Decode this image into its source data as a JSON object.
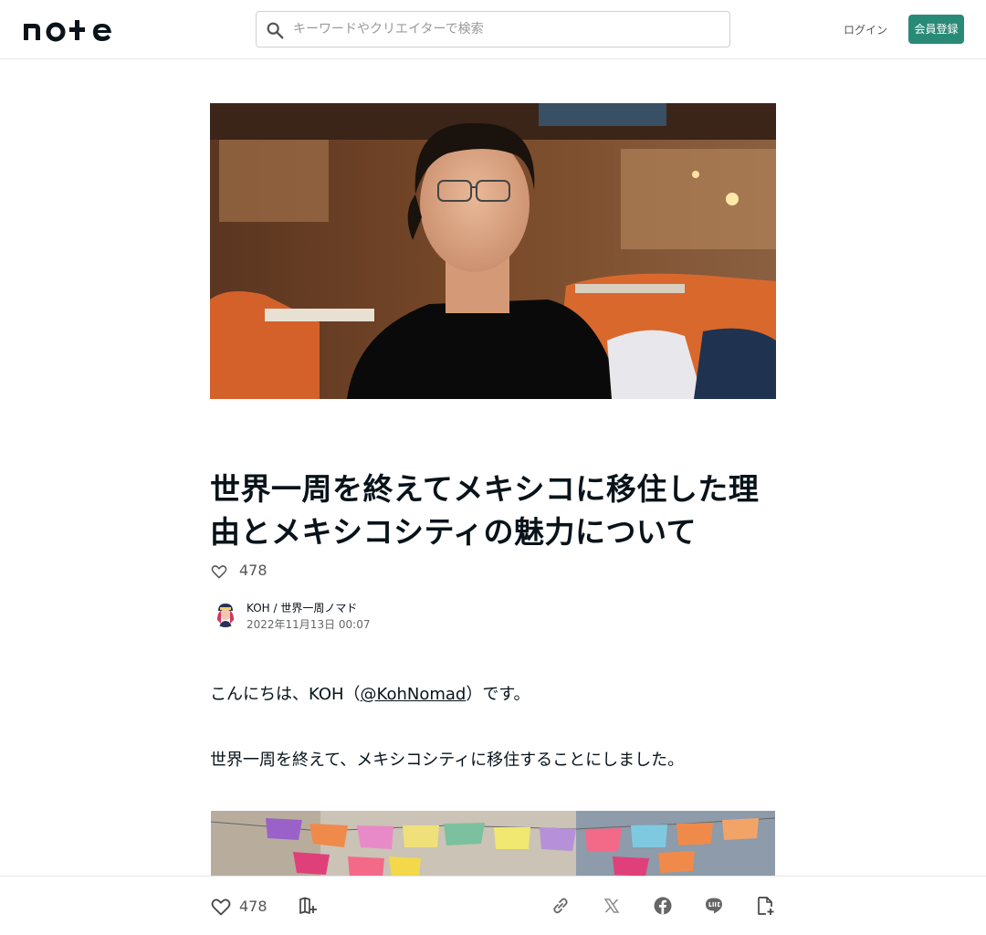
{
  "header": {
    "logo_text": "note",
    "search_placeholder": "キーワードやクリエイターで検索",
    "login_label": "ログイン",
    "signup_label": "会員登録",
    "accent_color": "#2a8a78"
  },
  "article": {
    "title": "世界一周を終えてメキシコに移住した理由とメキシコシティの魅力について",
    "like_count": "478",
    "author_name": "KOH / 世界一周ノマド",
    "published_at": "2022年11月13日 00:07",
    "paragraph1_before": "こんにちは、KOH（",
    "paragraph1_link": "@KohNomad",
    "paragraph1_after": "）です。",
    "paragraph2": "世界一周を終えて、メキシコシティに移住することにしました。"
  },
  "bottom_bar": {
    "like_count": "478",
    "icons": [
      "heart-icon",
      "magazine-add-icon",
      "link-icon",
      "x-icon",
      "facebook-icon",
      "line-icon",
      "note-add-icon"
    ]
  }
}
